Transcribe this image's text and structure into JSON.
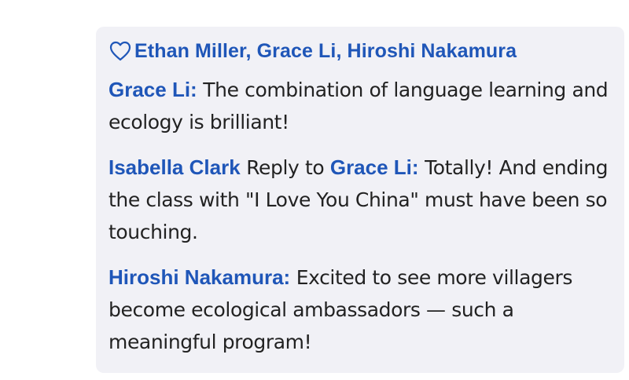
{
  "likes": {
    "icon": "heart-outline-icon",
    "names": "Ethan Miller, Grace Li, Hiroshi Nakamura",
    "color": "#1f56b8"
  },
  "comments": [
    {
      "author": "Grace Li:",
      "text": "The combination of language learning and ecology is brilliant!"
    },
    {
      "author": "Isabella Clark",
      "reply_word": "Reply to",
      "reply_target": "Grace Li:",
      "text": "Totally! And ending the class with \"I Love You China\" must have been so touching."
    },
    {
      "author": "Hiroshi Nakamura:",
      "text": "Excited to see more villagers become ecological ambassadors — such a meaningful program!"
    }
  ],
  "colors": {
    "panel_background": "#f1f1f6",
    "name_link": "#1f56b8",
    "body_text": "#222222"
  }
}
